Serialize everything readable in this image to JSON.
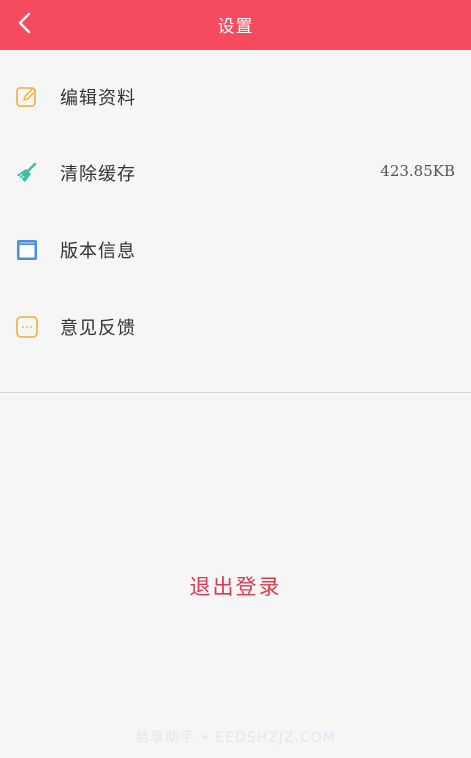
{
  "header": {
    "title": "设置",
    "back_icon": "chevron-left-icon",
    "background_color": "#f64a5f"
  },
  "menu": {
    "items": [
      {
        "icon": "edit-icon",
        "label": "编辑资料",
        "value": ""
      },
      {
        "icon": "broom-icon",
        "label": "清除缓存",
        "value": "423.85KB"
      },
      {
        "icon": "version-info-icon",
        "label": "版本信息",
        "value": ""
      },
      {
        "icon": "feedback-icon",
        "label": "意见反馈",
        "value": ""
      }
    ]
  },
  "logout": {
    "label": "退出登录",
    "color": "#e0394e"
  },
  "watermark": {
    "text": "易享助手 • EEDSHZJZ.COM"
  }
}
